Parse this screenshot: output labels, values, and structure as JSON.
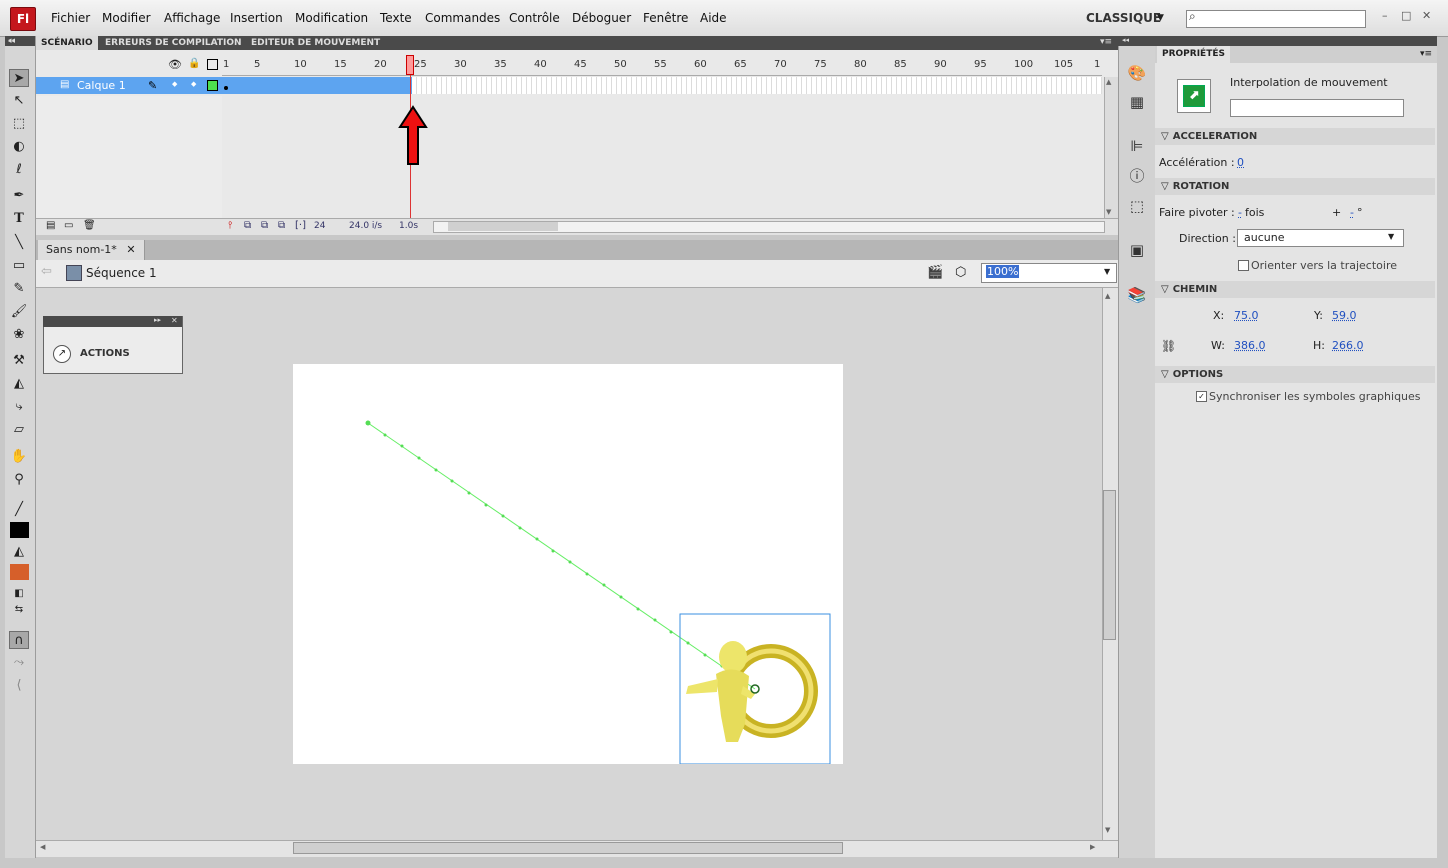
{
  "app": {
    "logo": "Fl",
    "menu": [
      "Fichier",
      "Modifier",
      "Affichage",
      "Insertion",
      "Modification",
      "Texte",
      "Commandes",
      "Contrôle",
      "Déboguer",
      "Fenêtre",
      "Aide"
    ],
    "workspace": "CLASSIQUE",
    "window_controls": [
      "–",
      "□",
      "✕"
    ]
  },
  "timeline": {
    "tabs": [
      "SCÉNARIO",
      "ERREURS DE COMPILATION",
      "EDITEUR DE MOUVEMENT"
    ],
    "layer_name": "Calque 1",
    "ruler": [
      "1",
      "5",
      "10",
      "15",
      "20",
      "25",
      "30",
      "35",
      "40",
      "45",
      "50",
      "55",
      "60",
      "65",
      "70",
      "75",
      "80",
      "85",
      "90",
      "95",
      "100",
      "105",
      "1"
    ],
    "current_frame": "24",
    "fps": "24.0 i/s",
    "time": "1.0s"
  },
  "document": {
    "tab_title": "Sans nom-1*",
    "tab_close": "✕",
    "scene": "Séquence 1",
    "zoom": "100%"
  },
  "actions_panel": {
    "label": "ACTIONS"
  },
  "properties": {
    "tab": "PROPRIÉTÉS",
    "tween_type": "Interpolation de mouvement",
    "sections": {
      "acceleration": "ACCELERATION",
      "rotation": "ROTATION",
      "chemin": "CHEMIN",
      "options": "OPTIONS"
    },
    "acceleration_label": "Accélération :",
    "acceleration_value": "0",
    "rotate_label": "Faire pivoter :",
    "rotate_count": "-",
    "rotate_unit": "fois",
    "rotate_plus": "+",
    "rotate_deg": "-",
    "rotate_deg_unit": "°",
    "direction_label": "Direction :",
    "direction_value": "aucune",
    "orient_label": "Orienter vers la trajectoire",
    "x_label": "X:",
    "x_value": "75.0",
    "y_label": "Y:",
    "y_value": "59.0",
    "w_label": "W:",
    "w_value": "386.0",
    "h_label": "H:",
    "h_value": "266.0",
    "sync_label": "Synchroniser les symboles graphiques"
  },
  "colors": {
    "accent_red": "#c4171d",
    "layer_blue": "#5da4f0",
    "path_green": "#66ee66",
    "fill_color": "#d65f2a"
  }
}
